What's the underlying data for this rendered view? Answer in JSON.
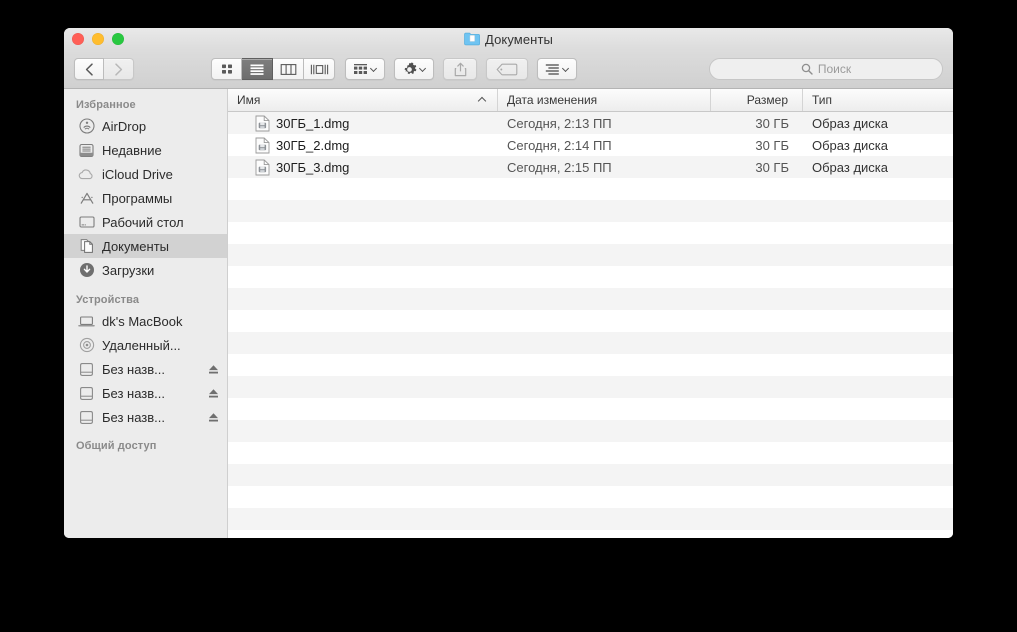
{
  "window": {
    "title": "Документы",
    "folder_icon": "blue-folder-icon",
    "traffic_lights": [
      "close-button",
      "minimize-button",
      "zoom-button"
    ]
  },
  "toolbar": {
    "back_label": "‹",
    "forward_label": "›",
    "view_buttons": [
      {
        "name": "icon-view",
        "active": false
      },
      {
        "name": "list-view",
        "active": true
      },
      {
        "name": "column-view",
        "active": false
      },
      {
        "name": "coverflow-view",
        "active": false
      }
    ],
    "arrange_label": "arrange-button",
    "action_label": "action-gear-button",
    "share_label": "share-button",
    "tag_label": "tag-button",
    "list_options_label": "list-options-button",
    "search": {
      "placeholder": "Поиск",
      "value": ""
    }
  },
  "sidebar": {
    "sections": [
      {
        "header": "Избранное",
        "items": [
          {
            "label": "AirDrop",
            "icon": "airdrop-icon",
            "selected": false,
            "eject": false
          },
          {
            "label": "Недавние",
            "icon": "recents-icon",
            "selected": false,
            "eject": false
          },
          {
            "label": "iCloud Drive",
            "icon": "icloud-icon",
            "selected": false,
            "eject": false
          },
          {
            "label": "Программы",
            "icon": "apps-icon",
            "selected": false,
            "eject": false
          },
          {
            "label": "Рабочий стол",
            "icon": "desktop-icon",
            "selected": false,
            "eject": false
          },
          {
            "label": "Документы",
            "icon": "documents-icon",
            "selected": true,
            "eject": false
          },
          {
            "label": "Загрузки",
            "icon": "downloads-icon",
            "selected": false,
            "eject": false
          }
        ]
      },
      {
        "header": "Устройства",
        "items": [
          {
            "label": "dk's MacBook",
            "icon": "laptop-icon",
            "selected": false,
            "eject": false
          },
          {
            "label": "Удаленный...",
            "icon": "disc-icon",
            "selected": false,
            "eject": false
          },
          {
            "label": "Без назв...",
            "icon": "drive-icon",
            "selected": false,
            "eject": true
          },
          {
            "label": "Без назв...",
            "icon": "drive-icon",
            "selected": false,
            "eject": true
          },
          {
            "label": "Без назв...",
            "icon": "drive-icon",
            "selected": false,
            "eject": true
          }
        ]
      },
      {
        "header": "Общий доступ",
        "clipped": true,
        "items": []
      }
    ]
  },
  "file_list": {
    "columns": [
      {
        "label": "Имя",
        "sorted": true,
        "sort_direction": "asc"
      },
      {
        "label": "Дата изменения",
        "sorted": false
      },
      {
        "label": "Размер",
        "sorted": false
      },
      {
        "label": "Тип",
        "sorted": false
      }
    ],
    "rows": [
      {
        "name": "30ГБ_1.dmg",
        "date": "Сегодня, 2:13 ПП",
        "size": "30 ГБ",
        "type": "Образ диска",
        "icon": "dmg-file-icon"
      },
      {
        "name": "30ГБ_2.dmg",
        "date": "Сегодня, 2:14 ПП",
        "size": "30 ГБ",
        "type": "Образ диска",
        "icon": "dmg-file-icon"
      },
      {
        "name": "30ГБ_3.dmg",
        "date": "Сегодня, 2:15 ПП",
        "size": "30 ГБ",
        "type": "Образ диска",
        "icon": "dmg-file-icon"
      }
    ],
    "empty_rows": 16
  },
  "colors": {
    "sidebar_bg": "#ececec",
    "selection": "#d2d2d2",
    "stripe": "#f4f4f4",
    "toolbar_top": "#dcdcdc",
    "folder_blue": "#6fc4f2",
    "active_view": "#6e6e6e"
  }
}
